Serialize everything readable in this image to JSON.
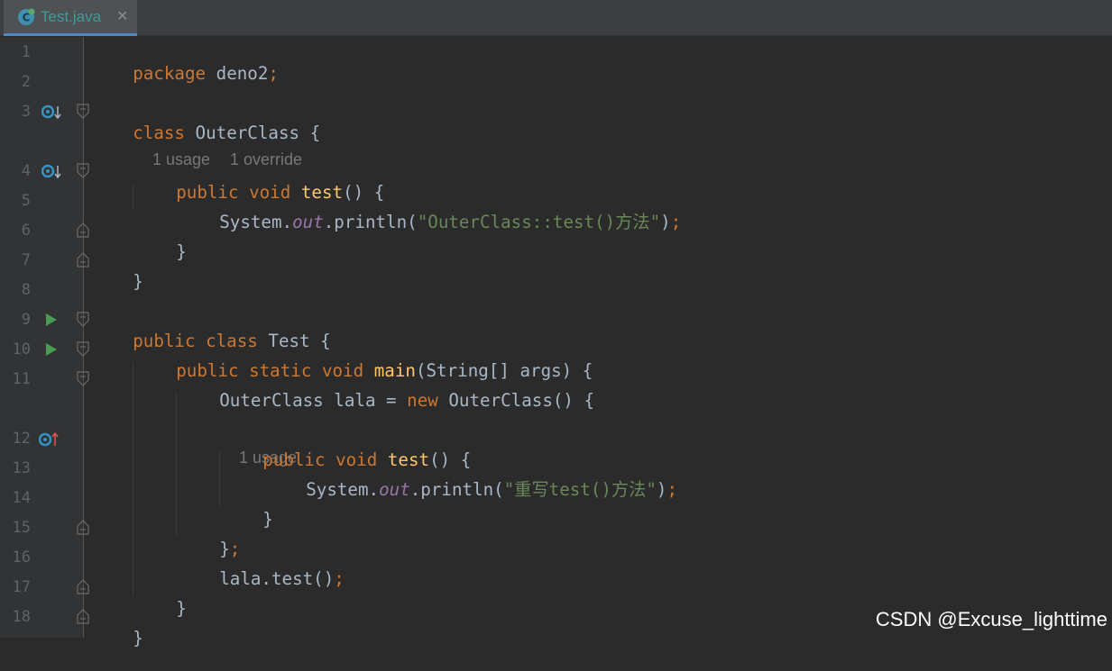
{
  "tab": {
    "label": "Test.java",
    "close": "✕",
    "icon": "java-class-icon"
  },
  "colors": {
    "background": "#2b2b2b",
    "gutter": "#313335",
    "keyword": "#cc7832",
    "method": "#ffc66d",
    "string": "#6a8759",
    "field": "#9876aa",
    "text": "#a9b7c6",
    "line_number": "#606366",
    "hint": "#787878"
  },
  "line_numbers": [
    "1",
    "2",
    "3",
    "4",
    "5",
    "6",
    "7",
    "8",
    "9",
    "10",
    "11",
    "12",
    "13",
    "14",
    "15",
    "16",
    "17",
    "18"
  ],
  "hints": {
    "outer_class_usage": "1 usage",
    "outer_class_override": "1 override",
    "anon_test_usage": "1 usage"
  },
  "code": {
    "l1": {
      "kw": "package",
      "rest": " deno2",
      "semi": ";"
    },
    "l3": {
      "kw": "class",
      "rest": " OuterClass {"
    },
    "l4": {
      "kw1": "public",
      "kw2": " void",
      "sp": " ",
      "fn": "test",
      "rest": "() {"
    },
    "l5": {
      "pre": "System.",
      "field": "out",
      "mid": ".println(",
      "str": "\"OuterClass::test()方法\"",
      "post": ")",
      "semi": ";"
    },
    "l6": {
      "text": "}"
    },
    "l7": {
      "text": "}"
    },
    "l9": {
      "kw1": "public",
      "kw2": " class",
      "rest": " Test {"
    },
    "l10": {
      "kw1": "public",
      "kw2": " static",
      "kw3": " void",
      "sp": " ",
      "fn": "main",
      "rest": "(String[] args) {"
    },
    "l11": {
      "pre": "OuterClass lala = ",
      "kw": "new",
      "rest": " OuterClass() {"
    },
    "l12": {
      "kw1": "public",
      "kw2": " void",
      "sp": " ",
      "fn": "test",
      "rest": "() {"
    },
    "l13": {
      "pre": "System.",
      "field": "out",
      "mid": ".println(",
      "str": "\"重写test()方法\"",
      "post": ")",
      "semi": ";"
    },
    "l14": {
      "text": "}"
    },
    "l15": {
      "text": "}",
      "semi": ";"
    },
    "l16": {
      "text": "lala.test()",
      "semi": ";"
    },
    "l17": {
      "text": "}"
    },
    "l18": {
      "text": "}"
    }
  },
  "gutter_marks": {
    "l3": "overridden-method-icon",
    "l4": "overridden-method-icon",
    "l9": "run-icon",
    "l10": "run-icon",
    "l12": "overriding-method-icon"
  },
  "watermark": "CSDN @Excuse_lighttime"
}
